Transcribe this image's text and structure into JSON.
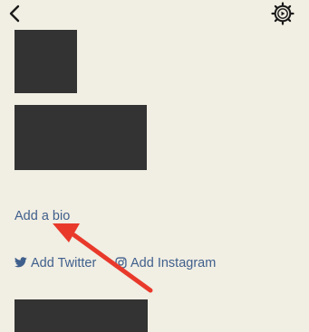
{
  "header": {
    "back_icon": "chevron-left-icon",
    "settings_icon": "gear-play-icon"
  },
  "profile": {
    "bio_link": "Add a bio",
    "social": {
      "twitter_label": "Add Twitter",
      "twitter_icon": "twitter-bird-icon",
      "instagram_label": "Add Instagram",
      "instagram_icon": "instagram-icon"
    }
  },
  "colors": {
    "background": "#f1eee3",
    "link": "#3f5f8c",
    "redaction": "#333333",
    "annotation_arrow": "#e8392b"
  }
}
